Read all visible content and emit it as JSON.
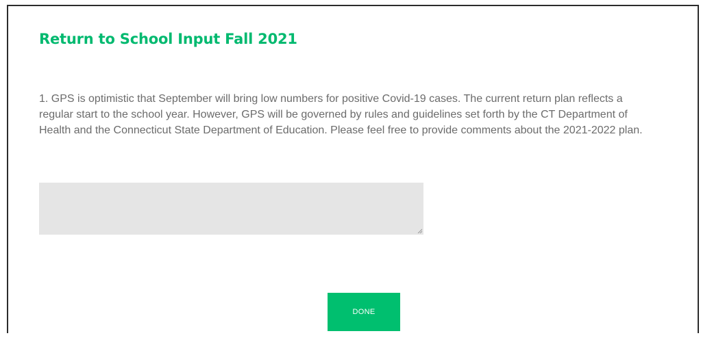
{
  "survey": {
    "title": "Return to School Input Fall 2021"
  },
  "question": {
    "text": "1. GPS is optimistic that September will bring low numbers for positive Covid-19 cases. The current return plan reflects a regular start to the school year. However, GPS will be governed by rules and guidelines set forth by the CT Department of Health and the Connecticut State Department of Education. Please feel free to provide comments about the 2021-2022 plan.",
    "comment_value": ""
  },
  "actions": {
    "done_label": "DONE"
  },
  "colors": {
    "accent": "#00bf6f",
    "title": "#00b96f",
    "text": "#6b6b6b",
    "input_bg": "#e5e5e5"
  },
  "icons": {
    "resize": "resize-handle-icon"
  }
}
